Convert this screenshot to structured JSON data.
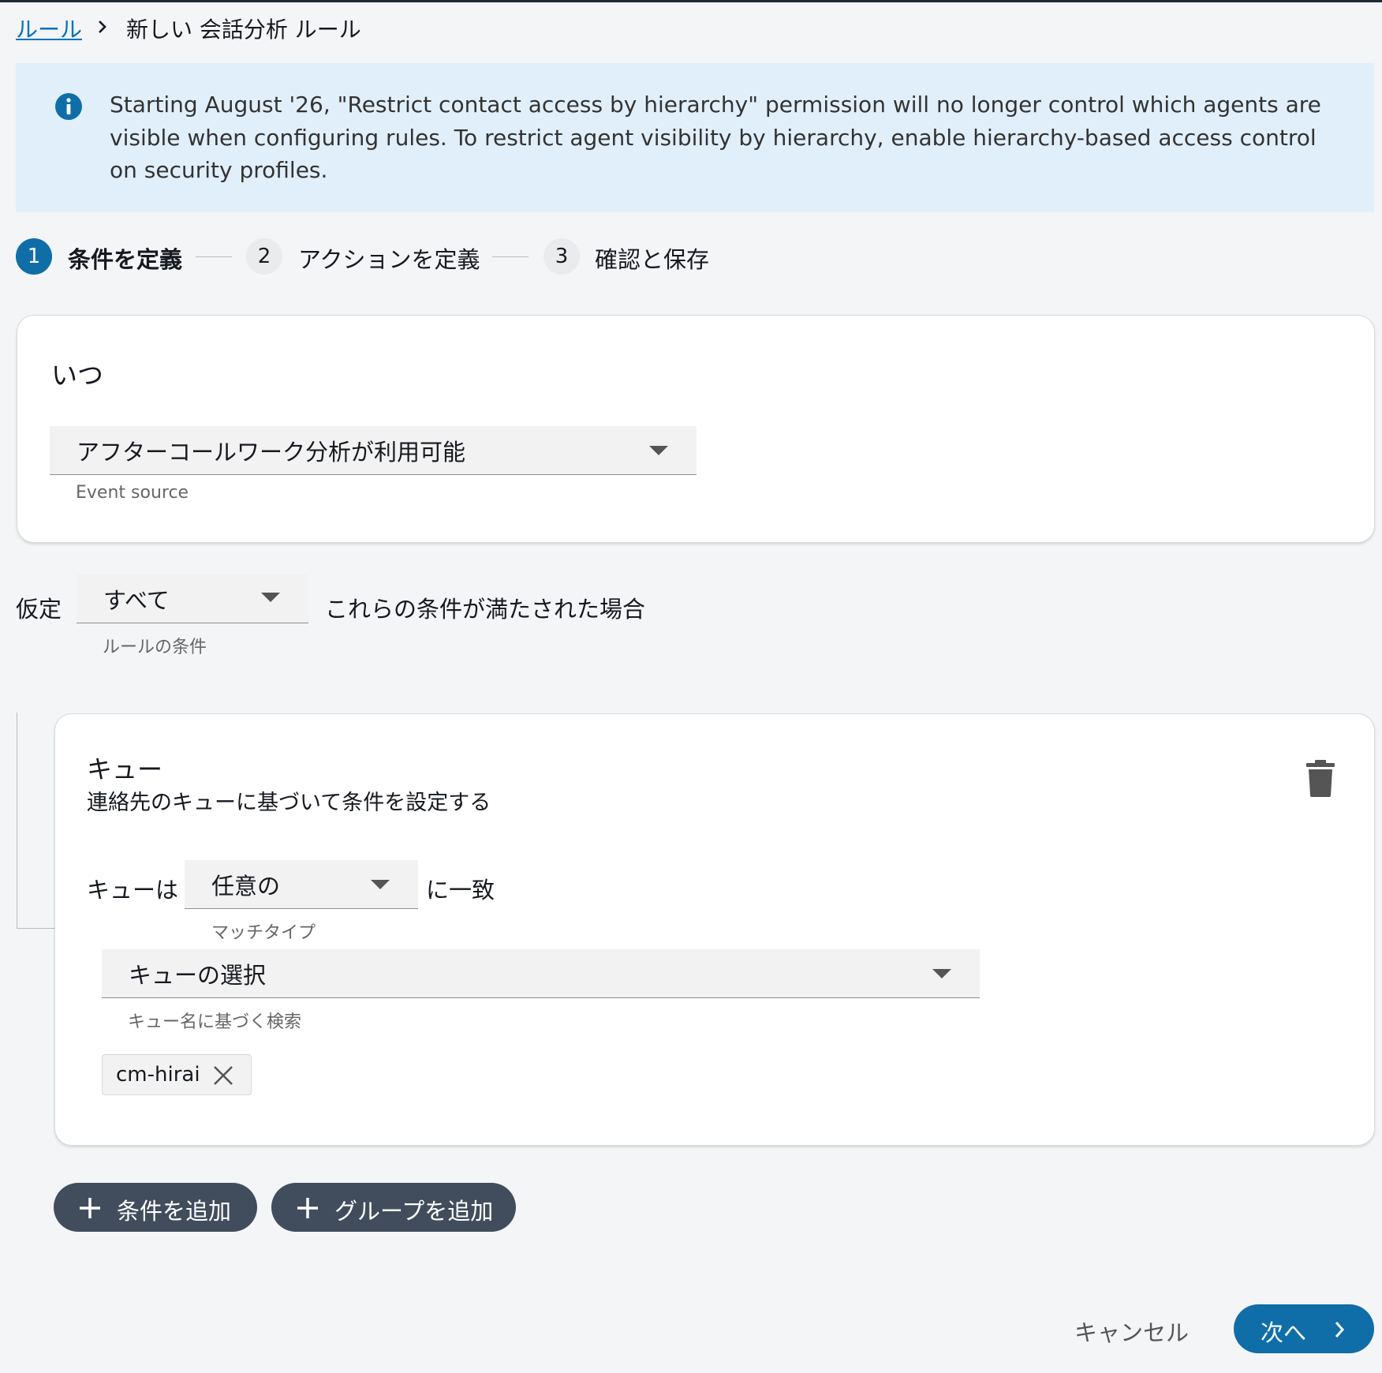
{
  "breadcrumb": {
    "parent": "ルール",
    "current": "新しい 会話分析 ルール"
  },
  "banner": {
    "icon": "info-icon",
    "text": "Starting August '26, \"Restrict contact access by hierarchy\" permission will no longer control which agents are visible when configuring rules. To restrict agent visibility by hierarchy, enable hierarchy-based access control on security profiles."
  },
  "steps": [
    {
      "number": "1",
      "label": "条件を定義",
      "active": true
    },
    {
      "number": "2",
      "label": "アクションを定義",
      "active": false
    },
    {
      "number": "3",
      "label": "確認と保存",
      "active": false
    }
  ],
  "when_card": {
    "title": "いつ",
    "event_select_value": "アフターコールワーク分析が利用可能",
    "event_helper": "Event source"
  },
  "assumption": {
    "prefix": "仮定",
    "select_value": "すべて",
    "suffix": "これらの条件が満たされた場合",
    "helper": "ルールの条件"
  },
  "queue_card": {
    "title": "キュー",
    "subtitle": "連絡先のキューに基づいて条件を設定する",
    "row_prefix": "キューは",
    "match_select_value": "任意の",
    "row_suffix": "に一致",
    "match_helper": "マッチタイプ",
    "queue_select_placeholder": "キューの選択",
    "queue_helper": "キュー名に基づく検索",
    "chips": [
      "cm-hirai"
    ]
  },
  "buttons": {
    "add_condition": "条件を追加",
    "add_group": "グループを追加",
    "cancel": "キャンセル",
    "next": "次へ"
  },
  "colors": {
    "primary": "#0f6ea8",
    "link": "#0073bb",
    "banner_bg": "#e1effb",
    "pill_bg": "#414d5c"
  }
}
